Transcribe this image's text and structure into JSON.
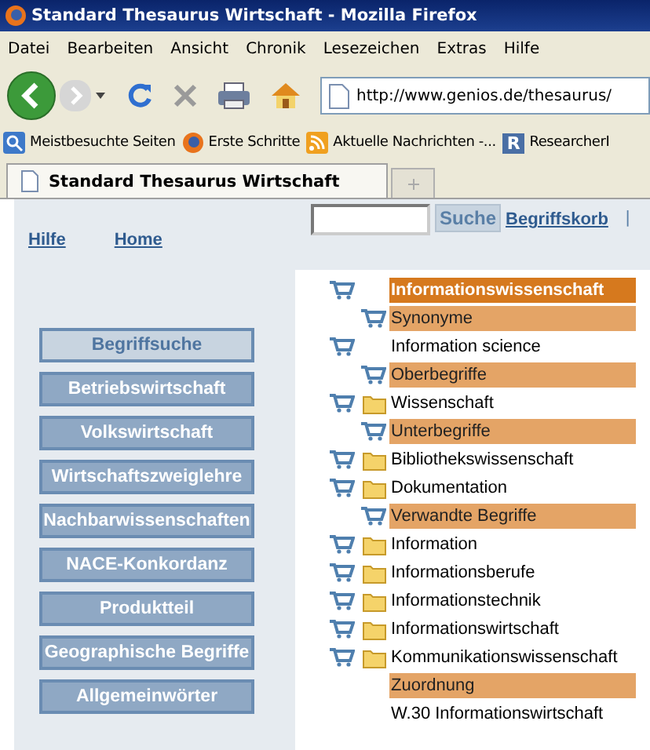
{
  "window": {
    "title": "Standard Thesaurus Wirtschaft - Mozilla Firefox"
  },
  "menu": [
    "Datei",
    "Bearbeiten",
    "Ansicht",
    "Chronik",
    "Lesezeichen",
    "Extras",
    "Hilfe"
  ],
  "address": {
    "value": "http://www.genios.de/thesaurus/"
  },
  "bookmarks": [
    {
      "label": "Meistbesuchte Seiten",
      "kind": "search"
    },
    {
      "label": "Erste Schritte",
      "kind": "globe"
    },
    {
      "label": "Aktuelle Nachrichten -...",
      "kind": "feed"
    },
    {
      "label": "ResearcherI",
      "kind": "letter",
      "letter": "R"
    }
  ],
  "tabs": [
    {
      "label": "Standard Thesaurus Wirtschaft",
      "selected": true
    }
  ],
  "page": {
    "links": [
      "Hilfe",
      "Home"
    ],
    "search": {
      "button": "Suche"
    },
    "basket": "Begriffskorb",
    "separator": "|",
    "nav": [
      {
        "label": "Begriffsuche",
        "selected": true
      },
      {
        "label": "Betriebswirtschaft",
        "selected": false
      },
      {
        "label": "Volkswirtschaft",
        "selected": false
      },
      {
        "label": "Wirtschaftszweiglehre",
        "selected": false
      },
      {
        "label": "Nachbarwissenschaften",
        "selected": false
      },
      {
        "label": "NACE-Konkordanz",
        "selected": false
      },
      {
        "label": "Produktteil",
        "selected": false
      },
      {
        "label": "Geographische Begriffe",
        "selected": false
      },
      {
        "label": "Allgemeinwörter",
        "selected": false
      }
    ],
    "tree": [
      {
        "kind": "title",
        "label": "Informationswissenschaft",
        "cart": true,
        "folder": false
      },
      {
        "kind": "section",
        "label": "Synonyme",
        "cart": true,
        "folder": false
      },
      {
        "kind": "term",
        "label": "Information science",
        "cart": true,
        "folder": false
      },
      {
        "kind": "section",
        "label": "Oberbegriffe",
        "cart": true,
        "folder": false
      },
      {
        "kind": "term",
        "label": "Wissenschaft",
        "cart": true,
        "folder": true
      },
      {
        "kind": "section",
        "label": "Unterbegriffe",
        "cart": true,
        "folder": false
      },
      {
        "kind": "term",
        "label": "Bibliothekswissenschaft",
        "cart": true,
        "folder": true
      },
      {
        "kind": "term",
        "label": "Dokumentation",
        "cart": true,
        "folder": true
      },
      {
        "kind": "section",
        "label": "Verwandte Begriffe",
        "cart": true,
        "folder": false
      },
      {
        "kind": "term",
        "label": "Information",
        "cart": true,
        "folder": true
      },
      {
        "kind": "term",
        "label": "Informationsberufe",
        "cart": true,
        "folder": true
      },
      {
        "kind": "term",
        "label": "Informationstechnik",
        "cart": true,
        "folder": true
      },
      {
        "kind": "term",
        "label": "Informationswirtschaft",
        "cart": true,
        "folder": true
      },
      {
        "kind": "term",
        "label": "Kommunikationswissenschaft",
        "cart": true,
        "folder": true
      },
      {
        "kind": "section",
        "label": "Zuordnung",
        "cart": false,
        "folder": false
      },
      {
        "kind": "term",
        "label": "W.30 Informationswirtschaft",
        "cart": false,
        "folder": false
      }
    ]
  }
}
